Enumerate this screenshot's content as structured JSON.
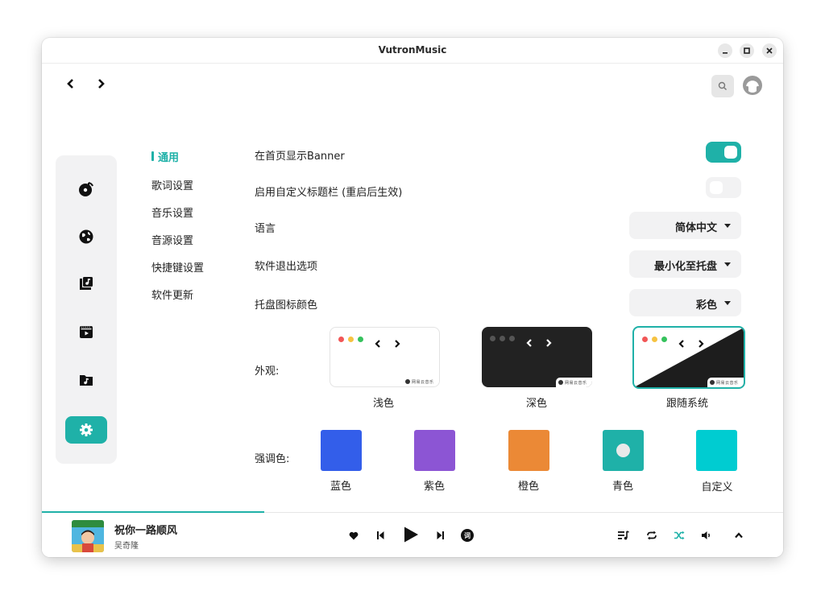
{
  "window": {
    "title": "VutronMusic"
  },
  "window_controls": [
    {
      "name": "minimize",
      "glyph": "minimize-icon"
    },
    {
      "name": "maximize",
      "glyph": "maximize-icon"
    },
    {
      "name": "close",
      "glyph": "close-icon"
    }
  ],
  "sidebar": {
    "items": [
      {
        "icon": "music-disc-icon"
      },
      {
        "icon": "globe-icon"
      },
      {
        "icon": "music-library-icon"
      },
      {
        "icon": "video-icon"
      },
      {
        "icon": "music-folder-icon"
      },
      {
        "icon": "gear-icon",
        "active": true
      }
    ]
  },
  "submenu": {
    "items": [
      {
        "label": "通用",
        "active": true
      },
      {
        "label": "歌词设置"
      },
      {
        "label": "音乐设置"
      },
      {
        "label": "音源设置"
      },
      {
        "label": "快捷键设置"
      },
      {
        "label": "软件更新"
      }
    ]
  },
  "settings": {
    "banner": {
      "label": "在首页显示Banner",
      "on": true
    },
    "titlebar": {
      "label": "启用自定义标题栏 (重启后生效)",
      "on": false
    },
    "language": {
      "label": "语言",
      "value": "简体中文"
    },
    "exit_option": {
      "label": "软件退出选项",
      "value": "最小化至托盘"
    },
    "tray_color": {
      "label": "托盘图标颜色",
      "value": "彩色"
    },
    "appearance": {
      "label": "外观:",
      "options": [
        {
          "name": "浅色",
          "badge": "网易云音乐"
        },
        {
          "name": "深色",
          "badge": "网易云音乐"
        },
        {
          "name": "跟随系统",
          "badge": "网易云音乐",
          "selected": true
        }
      ]
    },
    "accent": {
      "label": "强调色:",
      "options": [
        {
          "name": "蓝色",
          "color": "#335eea"
        },
        {
          "name": "紫色",
          "color": "#8c55d4"
        },
        {
          "name": "橙色",
          "color": "#eb8936"
        },
        {
          "name": "青色",
          "color": "#1fb1a8",
          "selected": true
        },
        {
          "name": "自定义",
          "color": "#00ccd1"
        }
      ]
    }
  },
  "player": {
    "song_title": "祝你一路顺风",
    "artist": "吴奇隆",
    "progress": 0.3,
    "lyrics_button": "词",
    "accent_color": "#1fb1a8"
  }
}
